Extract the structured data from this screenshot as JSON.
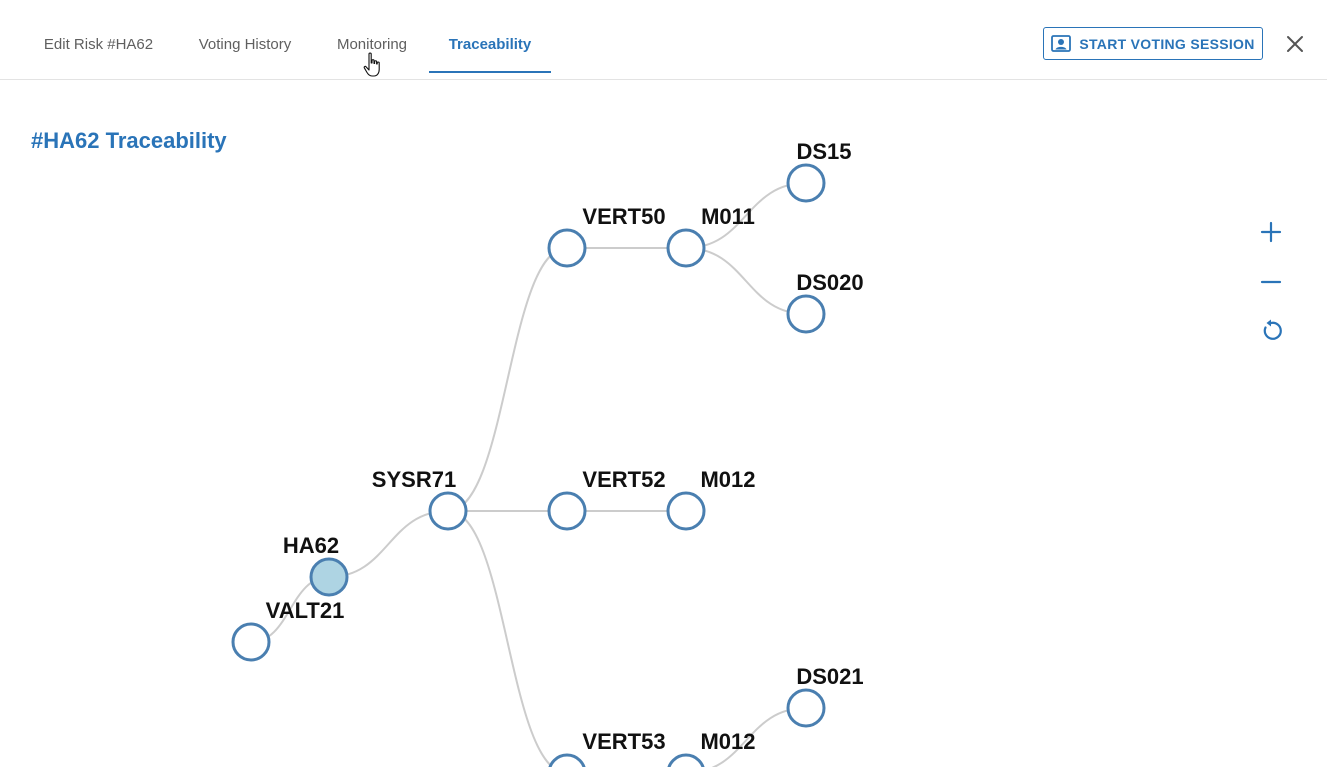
{
  "tabs": [
    {
      "label": "Edit Risk #HA62",
      "active": false
    },
    {
      "label": "Voting History",
      "active": false
    },
    {
      "label": "Monitoring",
      "active": false
    },
    {
      "label": "Traceability",
      "active": true
    }
  ],
  "header": {
    "voting_button_label": "START VOTING SESSION",
    "voting_button_icon": "person-badge-icon",
    "close_icon": "close-icon"
  },
  "page": {
    "title": "#HA62 Traceability"
  },
  "graph": {
    "nodes": [
      {
        "id": "VALT21",
        "label": "VALT21",
        "selected": false
      },
      {
        "id": "HA62",
        "label": "HA62",
        "selected": true
      },
      {
        "id": "SYSR71",
        "label": "SYSR71",
        "selected": false
      },
      {
        "id": "VERT50",
        "label": "VERT50",
        "selected": false
      },
      {
        "id": "M011",
        "label": "M011",
        "selected": false
      },
      {
        "id": "DS15",
        "label": "DS15",
        "selected": false
      },
      {
        "id": "DS020",
        "label": "DS020",
        "selected": false
      },
      {
        "id": "VERT52",
        "label": "VERT52",
        "selected": false
      },
      {
        "id": "M012a",
        "label": "M012",
        "selected": false
      },
      {
        "id": "VERT53",
        "label": "VERT53",
        "selected": false
      },
      {
        "id": "M012b",
        "label": "M012",
        "selected": false
      },
      {
        "id": "DS021",
        "label": "DS021",
        "selected": false
      }
    ],
    "edges": [
      [
        "VALT21",
        "HA62"
      ],
      [
        "HA62",
        "SYSR71"
      ],
      [
        "SYSR71",
        "VERT50"
      ],
      [
        "SYSR71",
        "VERT52"
      ],
      [
        "SYSR71",
        "VERT53"
      ],
      [
        "VERT50",
        "M011"
      ],
      [
        "M011",
        "DS15"
      ],
      [
        "M011",
        "DS020"
      ],
      [
        "VERT52",
        "M012a"
      ],
      [
        "VERT53",
        "M012b"
      ],
      [
        "M012b",
        "DS021"
      ]
    ],
    "colors": {
      "node_stroke": "#4a7fb0",
      "node_fill": "#ffffff",
      "selected_fill": "#aed4e3",
      "edge": "#cccccc"
    }
  },
  "zoom_controls": {
    "zoom_in_icon": "plus-icon",
    "zoom_out_icon": "minus-icon",
    "reset_icon": "reset-icon"
  }
}
